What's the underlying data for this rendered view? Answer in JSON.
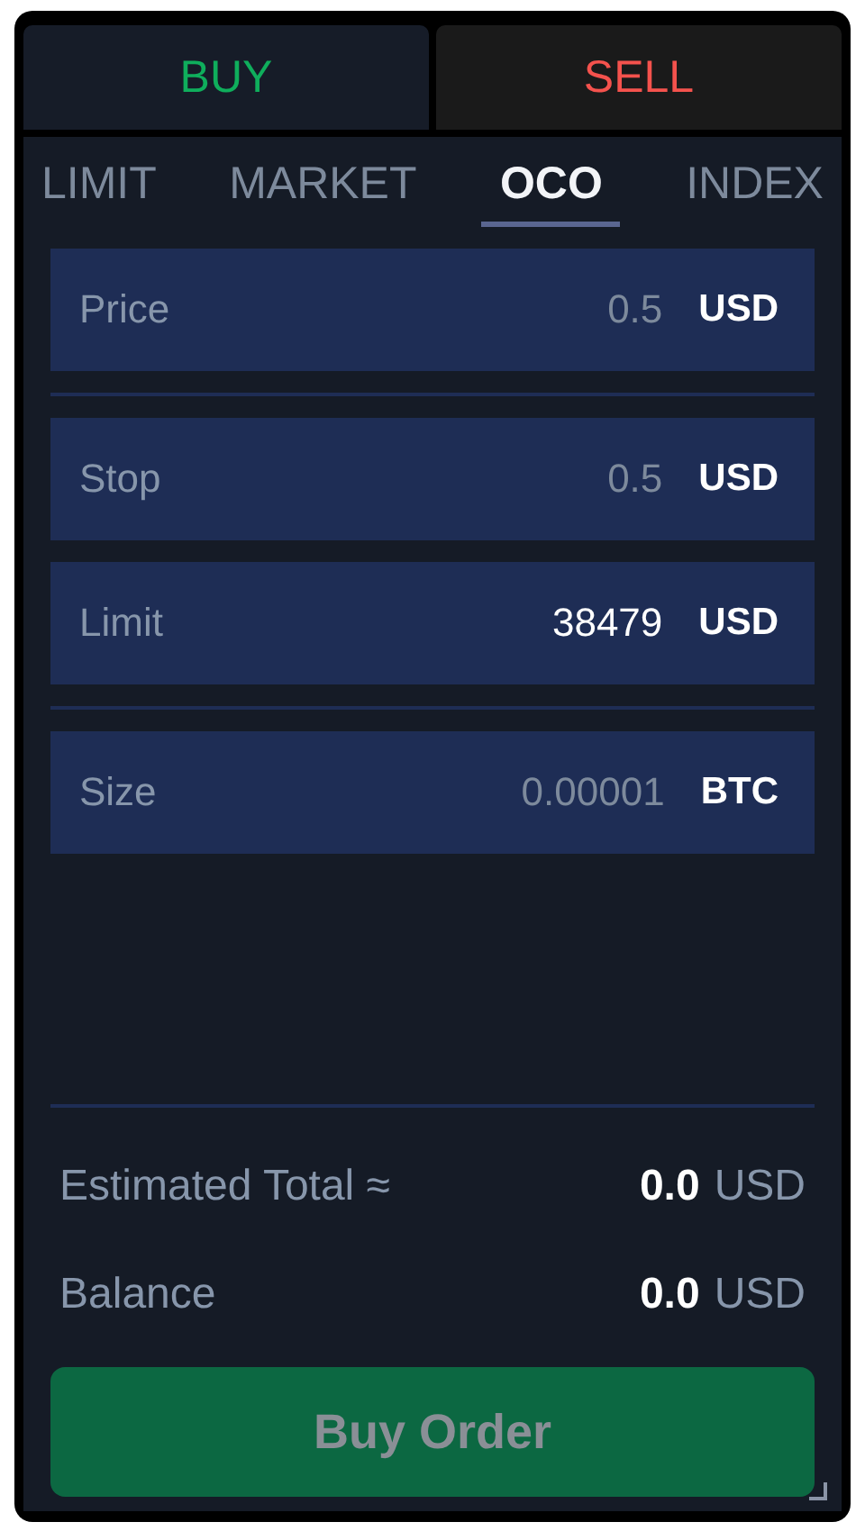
{
  "sides": [
    {
      "label": "BUY",
      "selected": true,
      "kind": "buy"
    },
    {
      "label": "SELL",
      "selected": false,
      "kind": "sell"
    }
  ],
  "order_types": [
    {
      "label": "LIMIT",
      "selected": false
    },
    {
      "label": "MARKET",
      "selected": false
    },
    {
      "label": "OCO",
      "selected": true
    },
    {
      "label": "INDEX",
      "selected": false
    }
  ],
  "field_groups": [
    [
      {
        "label": "Price",
        "placeholder": "0.5",
        "unit": "USD"
      }
    ],
    [
      {
        "label": "Stop",
        "placeholder": "0.5",
        "unit": "USD"
      },
      {
        "label": "Limit",
        "value": "38479",
        "unit": "USD"
      }
    ],
    [
      {
        "label": "Size",
        "placeholder": "0.00001",
        "unit": "BTC"
      }
    ]
  ],
  "summary": [
    {
      "label": "Estimated Total ≈",
      "amount": "0.0",
      "currency": "USD"
    },
    {
      "label": "Balance",
      "amount": "0.0",
      "currency": "USD"
    }
  ],
  "submit": {
    "label": "Buy Order",
    "disabled": true
  }
}
